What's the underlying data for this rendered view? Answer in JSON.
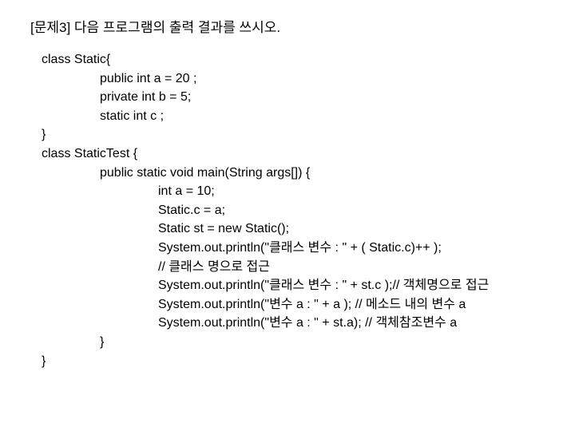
{
  "slide": {
    "title": "[문제3] 다음 프로그램의 출력 결과를 쓰시오.",
    "background_color": "#ffffff",
    "text_color": "#000000",
    "code_lines": [
      {
        "indent": 0,
        "text": "class Static{"
      },
      {
        "indent": 1,
        "text": "public int a = 20 ;"
      },
      {
        "indent": 1,
        "text": "private int b = 5;"
      },
      {
        "indent": 1,
        "text": "static int c ;"
      },
      {
        "indent": 0,
        "text": "}"
      },
      {
        "indent": 0,
        "text": "class StaticTest {"
      },
      {
        "indent": 1,
        "text": "public static void main(String args[]) {"
      },
      {
        "indent": 2,
        "text": "int a = 10;"
      },
      {
        "indent": 2,
        "text": "Static.c = a;"
      },
      {
        "indent": 2,
        "text": "Static st = new Static();"
      },
      {
        "indent": 2,
        "text": "System.out.println(\"클래스 변수 : \" + ( Static.c)++ );"
      },
      {
        "indent": 2,
        "text": "// 클래스 명으로 접근"
      },
      {
        "indent": 2,
        "text": "System.out.println(\"클래스 변수 : \" + st.c );// 객체명으로 접근"
      },
      {
        "indent": 2,
        "text": "System.out.println(\"변수 a : \" + a ); // 메소드 내의 변수 a"
      },
      {
        "indent": 2,
        "text": "System.out.println(\"변수 a : \" + st.a); // 객체참조변수 a"
      },
      {
        "indent": 1,
        "text": "}"
      },
      {
        "indent": 0,
        "text": "}"
      }
    ]
  }
}
